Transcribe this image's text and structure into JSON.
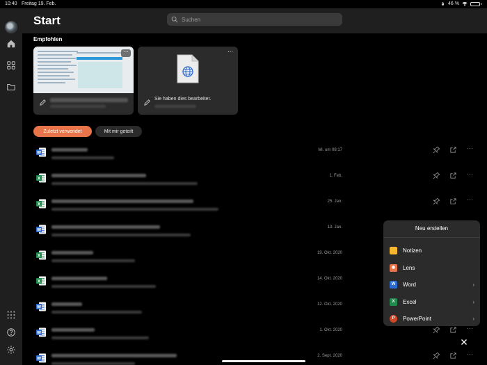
{
  "status_bar": {
    "time": "10:40",
    "date": "Freitag 19. Feb.",
    "battery": "46 %"
  },
  "header": {
    "title": "Start",
    "search_placeholder": "Suchen"
  },
  "recommended": {
    "title": "Empfohlen",
    "cards": [
      {
        "caption": ""
      },
      {
        "caption": "Sie haben dies bearbeitet."
      }
    ]
  },
  "tabs": [
    {
      "label": "Zuletzt verwendet",
      "active": true
    },
    {
      "label": "Mit mir geteilt",
      "active": false
    }
  ],
  "files": [
    {
      "type": "word",
      "date": "Mi. um 08:17"
    },
    {
      "type": "excel",
      "date": "1. Feb."
    },
    {
      "type": "excel",
      "date": "25. Jan."
    },
    {
      "type": "word",
      "date": "13. Jan."
    },
    {
      "type": "excel",
      "date": "19. Okt. 2020"
    },
    {
      "type": "excel",
      "date": "14. Okt. 2020"
    },
    {
      "type": "word",
      "date": "12. Okt. 2020"
    },
    {
      "type": "word",
      "date": "1. Okt. 2020"
    },
    {
      "type": "word",
      "date": "2. Sept. 2020"
    }
  ],
  "new_menu": {
    "title": "Neu erstellen",
    "items": [
      {
        "label": "Notizen",
        "icon": "notes-icon",
        "color": "#f5b82e",
        "has_submenu": false
      },
      {
        "label": "Lens",
        "icon": "lens-icon",
        "color": "#e8744a",
        "has_submenu": false
      },
      {
        "label": "Word",
        "icon": "word-icon",
        "color": "#2b6bd1",
        "has_submenu": true
      },
      {
        "label": "Excel",
        "icon": "excel-icon",
        "color": "#1f8a4c",
        "has_submenu": true
      },
      {
        "label": "PowerPoint",
        "icon": "powerpoint-icon",
        "color": "#d24726",
        "has_submenu": true
      }
    ]
  },
  "colors": {
    "accent": "#e8744a",
    "word": "#2b6bd1",
    "excel": "#1f8a4c"
  }
}
